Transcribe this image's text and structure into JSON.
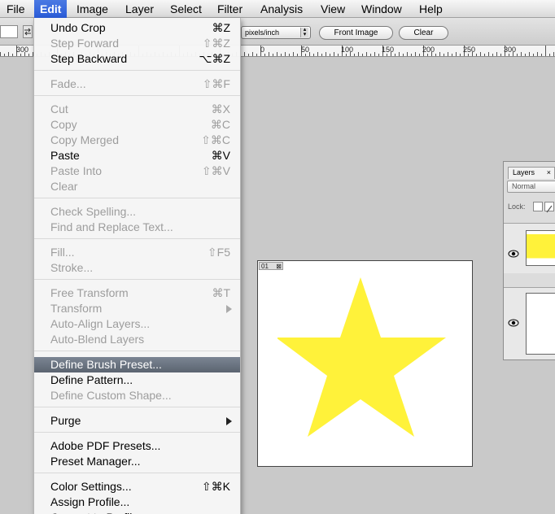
{
  "menubar": {
    "items": [
      "File",
      "Edit",
      "Image",
      "Layer",
      "Select",
      "Filter",
      "Analysis",
      "View",
      "Window",
      "Help"
    ],
    "active": "Edit"
  },
  "options_bar": {
    "resolution_units": "pixels/inch",
    "front_image_button": "Front Image",
    "clear_button": "Clear"
  },
  "ruler": {
    "left_labels": [
      "300"
    ],
    "right_labels": [
      "0",
      "50",
      "100",
      "150",
      "200",
      "250",
      "300"
    ]
  },
  "edit_menu": {
    "items": [
      {
        "label": "Undo Crop",
        "shortcut": "⌘Z",
        "enabled": true
      },
      {
        "label": "Step Forward",
        "shortcut": "⇧⌘Z",
        "enabled": false
      },
      {
        "label": "Step Backward",
        "shortcut": "⌥⌘Z",
        "enabled": true
      },
      {
        "label": "Fade...",
        "shortcut": "⇧⌘F",
        "enabled": false
      },
      {
        "label": "Cut",
        "shortcut": "⌘X",
        "enabled": false
      },
      {
        "label": "Copy",
        "shortcut": "⌘C",
        "enabled": false
      },
      {
        "label": "Copy Merged",
        "shortcut": "⇧⌘C",
        "enabled": false
      },
      {
        "label": "Paste",
        "shortcut": "⌘V",
        "enabled": true
      },
      {
        "label": "Paste Into",
        "shortcut": "⇧⌘V",
        "enabled": false
      },
      {
        "label": "Clear",
        "shortcut": "",
        "enabled": false
      },
      {
        "label": "Check Spelling...",
        "shortcut": "",
        "enabled": false
      },
      {
        "label": "Find and Replace Text...",
        "shortcut": "",
        "enabled": false
      },
      {
        "label": "Fill...",
        "shortcut": "⇧F5",
        "enabled": false
      },
      {
        "label": "Stroke...",
        "shortcut": "",
        "enabled": false
      },
      {
        "label": "Free Transform",
        "shortcut": "⌘T",
        "enabled": false
      },
      {
        "label": "Transform",
        "shortcut": "",
        "enabled": false,
        "submenu": true
      },
      {
        "label": "Auto-Align Layers...",
        "shortcut": "",
        "enabled": false
      },
      {
        "label": "Auto-Blend Layers",
        "shortcut": "",
        "enabled": false
      },
      {
        "label": "Define Brush Preset...",
        "shortcut": "",
        "enabled": true,
        "highlighted": true
      },
      {
        "label": "Define Pattern...",
        "shortcut": "",
        "enabled": true
      },
      {
        "label": "Define Custom Shape...",
        "shortcut": "",
        "enabled": false
      },
      {
        "label": "Purge",
        "shortcut": "",
        "enabled": true,
        "submenu": true
      },
      {
        "label": "Adobe PDF Presets...",
        "shortcut": "",
        "enabled": true
      },
      {
        "label": "Preset Manager...",
        "shortcut": "",
        "enabled": true
      },
      {
        "label": "Color Settings...",
        "shortcut": "⇧⌘K",
        "enabled": true
      },
      {
        "label": "Assign Profile...",
        "shortcut": "",
        "enabled": true
      },
      {
        "label": "Convert to Profile...",
        "shortcut": "",
        "enabled": true
      }
    ]
  },
  "document": {
    "tab_label": "01",
    "shape_color": "#fff23a"
  },
  "layers_panel": {
    "tab_label": "Layers",
    "blend_mode": "Normal",
    "lock_label": "Lock:",
    "layer_thumb_colors": [
      "#fff23a",
      "#ffffff"
    ]
  }
}
